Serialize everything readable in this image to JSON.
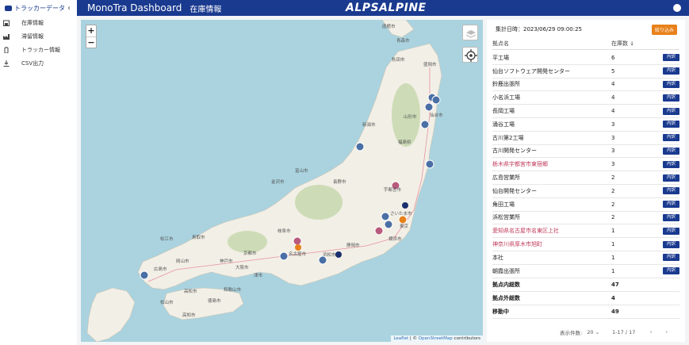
{
  "sidebar": {
    "header": "トラッカーデータ",
    "items": [
      {
        "label": "在庫情報",
        "icon": "warehouse-icon"
      },
      {
        "label": "滞留情報",
        "icon": "factory-icon"
      },
      {
        "label": "トラッカー情報",
        "icon": "tracker-icon"
      },
      {
        "label": "CSV出力",
        "icon": "download-icon"
      }
    ]
  },
  "topbar": {
    "title": "MonoTra Dashboard",
    "page": "在庫情報",
    "logo": "ALPSALPINE",
    "brand_color": "#1a3a8f"
  },
  "map": {
    "zoom_in": "+",
    "zoom_out": "−",
    "attribution_leaflet": "Leaflet",
    "attribution_sep": " | © ",
    "attribution_osm": "OpenStreetMap",
    "attribution_tail": " contributors",
    "place_labels": {
      "hokkaido_city": "函館市",
      "aomori": "青森市",
      "akita": "秋田市",
      "morioka": "盛岡市",
      "yamagata": "山形市",
      "sendai": "仙台市",
      "niigata": "新潟市",
      "fukushima": "福島県",
      "nagano": "長野市",
      "toyama": "富山市",
      "kanazawa": "金沢市",
      "utsunomiya": "宇都宮市",
      "saitama": "さいたま市",
      "tokyo": "東京",
      "yokohama": "横浜市",
      "shizuoka": "静岡市",
      "hamamatsu": "浜松市",
      "nagoya": "名古屋市",
      "gifu": "岐阜市",
      "osaka": "大阪市",
      "kyoto": "京都市",
      "kobe": "神戸市",
      "hiroshima": "広島市",
      "okayama": "岡山市",
      "matsue": "松江市",
      "tottori": "鳥取市",
      "takamatsu": "高松市",
      "kochi": "高知市",
      "matsuyama": "松山市",
      "tokushima": "徳島市",
      "wakayama": "和歌山市",
      "tsu": "津市"
    }
  },
  "panel": {
    "timestamp": "集計日時：2023/06/29 09:00:25",
    "filter_label": "絞り込み",
    "col_name": "拠点名",
    "col_count": "在庫数 ↓",
    "detail_label": "内訳",
    "rows": [
      {
        "name": "平工場",
        "count": "6",
        "alert": false
      },
      {
        "name": "仙台ソフトウェア開発センター",
        "count": "5",
        "alert": false
      },
      {
        "name": "鈴鹿出張所",
        "count": "4",
        "alert": false
      },
      {
        "name": "小名浜工場",
        "count": "4",
        "alert": false
      },
      {
        "name": "長岡工場",
        "count": "4",
        "alert": false
      },
      {
        "name": "涌谷工場",
        "count": "3",
        "alert": false
      },
      {
        "name": "古川第2工場",
        "count": "3",
        "alert": false
      },
      {
        "name": "古川開発センター",
        "count": "3",
        "alert": false
      },
      {
        "name": "栃木県宇都宮市東宿郷",
        "count": "3",
        "alert": true
      },
      {
        "name": "広島営業所",
        "count": "2",
        "alert": false
      },
      {
        "name": "仙台開発センター",
        "count": "2",
        "alert": false
      },
      {
        "name": "角田工場",
        "count": "2",
        "alert": false
      },
      {
        "name": "浜松営業所",
        "count": "2",
        "alert": false
      },
      {
        "name": "愛知県名古屋市名東区上社",
        "count": "1",
        "alert": true
      },
      {
        "name": "神奈川県厚木市旭町",
        "count": "1",
        "alert": true
      },
      {
        "name": "本社",
        "count": "1",
        "alert": false
      },
      {
        "name": "朝霞出張所",
        "count": "1",
        "alert": false
      }
    ],
    "summary": [
      {
        "label": "拠点内総数",
        "value": "47"
      },
      {
        "label": "拠点外総数",
        "value": "4"
      },
      {
        "label": "移動中",
        "value": "49"
      }
    ],
    "pager": {
      "per_page_label": "表示件数:",
      "per_page": "20",
      "range": "1-17 / 17"
    }
  },
  "colors": {
    "accent": "#1a3a8f",
    "filter": "#e8811a",
    "alert_text": "#c0395a",
    "sea": "#aad3df",
    "land": "#f2efe6"
  }
}
